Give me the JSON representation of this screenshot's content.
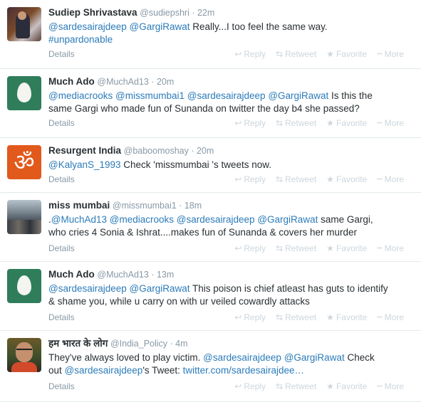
{
  "actions": {
    "details": "Details",
    "reply": "Reply",
    "retweet": "Retweet",
    "favorite": "Favorite",
    "more": "More"
  },
  "tweets": [
    {
      "fullname": "Sudiep Shrivastava",
      "handle": "@sudiepshri",
      "time": "22m",
      "avatar": "sudiep-avatar",
      "line1": [
        {
          "t": "@sardesairajdeep",
          "k": "mention"
        },
        {
          "t": " ",
          "k": "text"
        },
        {
          "t": "@GargiRawat",
          "k": "mention"
        },
        {
          "t": " Really...I too feel the same way.",
          "k": "text"
        }
      ],
      "line2": [
        {
          "t": "#unpardonable",
          "k": "hashtag"
        }
      ]
    },
    {
      "fullname": "Much Ado",
      "handle": "@MuchAd13",
      "time": "20m",
      "avatar": "egg-avatar",
      "line1": [
        {
          "t": "@mediacrooks",
          "k": "mention"
        },
        {
          "t": " ",
          "k": "text"
        },
        {
          "t": "@missmumbai1",
          "k": "mention"
        },
        {
          "t": " ",
          "k": "text"
        },
        {
          "t": "@sardesairajdeep",
          "k": "mention"
        },
        {
          "t": " ",
          "k": "text"
        },
        {
          "t": "@GargiRawat",
          "k": "mention"
        },
        {
          "t": " Is this the",
          "k": "text"
        }
      ],
      "line2": [
        {
          "t": "same Gargi who made fun of Sunanda on twitter the day b4 she passed?",
          "k": "text"
        }
      ]
    },
    {
      "fullname": "Resurgent India",
      "handle": "@baboomoshay",
      "time": "20m",
      "avatar": "om-avatar",
      "line1": [
        {
          "t": "@KalyanS_1993",
          "k": "mention"
        },
        {
          "t": " Check 'missmumbai 's tweets now.",
          "k": "text"
        }
      ],
      "line2": []
    },
    {
      "fullname": "miss mumbai",
      "handle": "@missmumbai1",
      "time": "18m",
      "avatar": "landscape-avatar",
      "line1": [
        {
          "t": ".",
          "k": "text"
        },
        {
          "t": "@MuchAd13",
          "k": "mention"
        },
        {
          "t": " ",
          "k": "text"
        },
        {
          "t": "@mediacrooks",
          "k": "mention"
        },
        {
          "t": " ",
          "k": "text"
        },
        {
          "t": "@sardesairajdeep",
          "k": "mention"
        },
        {
          "t": " ",
          "k": "text"
        },
        {
          "t": "@GargiRawat",
          "k": "mention"
        },
        {
          "t": " same Gargi,",
          "k": "text"
        }
      ],
      "line2": [
        {
          "t": "who cries 4 Sonia & Ishrat....makes fun of Sunanda & covers her murder",
          "k": "text"
        }
      ]
    },
    {
      "fullname": "Much Ado",
      "handle": "@MuchAd13",
      "time": "13m",
      "avatar": "egg-avatar",
      "line1": [
        {
          "t": "@sardesairajdeep",
          "k": "mention"
        },
        {
          "t": " ",
          "k": "text"
        },
        {
          "t": "@GargiRawat",
          "k": "mention"
        },
        {
          "t": " This poison is chief atleast has guts to identify",
          "k": "text"
        }
      ],
      "line2": [
        {
          "t": "& shame you, while u carry on with ur veiled cowardly attacks",
          "k": "text"
        }
      ]
    },
    {
      "fullname": "हम भारत के लोग",
      "handle": "@India_Policy",
      "time": "4m",
      "avatar": "person-avatar",
      "line1": [
        {
          "t": "They've always loved to play victim. ",
          "k": "text"
        },
        {
          "t": "@sardesairajdeep",
          "k": "mention"
        },
        {
          "t": " ",
          "k": "text"
        },
        {
          "t": "@GargiRawat",
          "k": "mention"
        },
        {
          "t": " Check",
          "k": "text"
        }
      ],
      "line2": [
        {
          "t": "out ",
          "k": "text"
        },
        {
          "t": "@sardesairajdeep",
          "k": "mention"
        },
        {
          "t": "'s Tweet: ",
          "k": "text"
        },
        {
          "t": "twitter.com/sardesairajdee…",
          "k": "link"
        }
      ]
    }
  ]
}
